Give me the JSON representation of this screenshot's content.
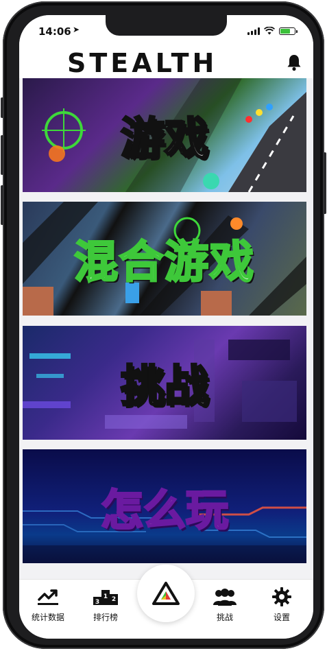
{
  "status_bar": {
    "time": "14:06",
    "location_glyph": "➤"
  },
  "header": {
    "logo_text": "STEALTH"
  },
  "tiles": [
    {
      "title": "游戏"
    },
    {
      "title": "混合游戏"
    },
    {
      "title": "挑战"
    },
    {
      "title": "怎么玩"
    }
  ],
  "bottom_nav": {
    "items": [
      {
        "label": "统计数据",
        "icon": "trend-chart-icon"
      },
      {
        "label": "排行榜",
        "icon": "podium-icon"
      },
      {
        "label": "",
        "icon": "stealth-logo-icon"
      },
      {
        "label": "挑战",
        "icon": "users-icon"
      },
      {
        "label": "设置",
        "icon": "gear-icon"
      }
    ]
  },
  "podium_digits": [
    "3",
    "1",
    "2"
  ],
  "colors": {
    "battery_fill": "#3cc13b",
    "mixed_title_outline": "#3ec83a",
    "howto_title": "#ffb8f0"
  }
}
